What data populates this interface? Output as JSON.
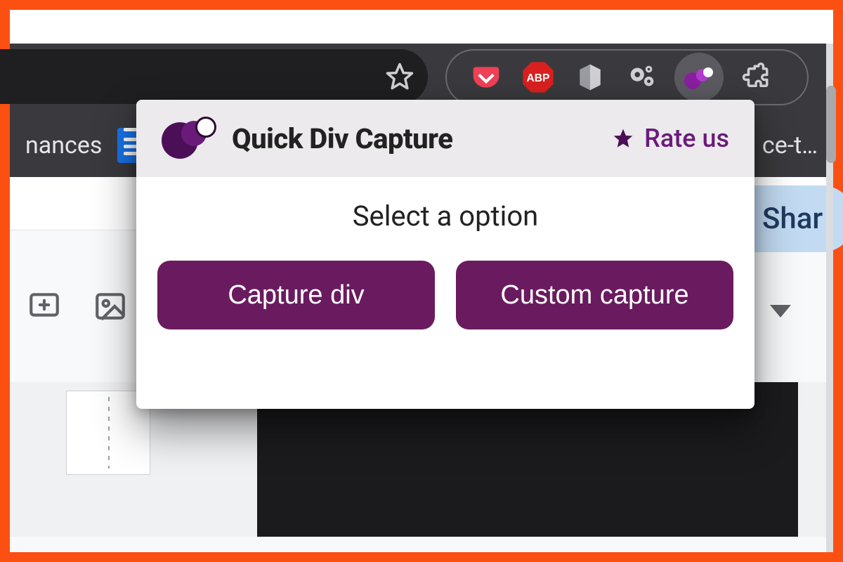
{
  "chrome": {
    "bookmarks_left_text": "nances",
    "bookmarks_right_text": "ce-t…"
  },
  "docs_page": {
    "share_label": "Shar"
  },
  "popup": {
    "title": "Quick Div Capture",
    "rate_label": "Rate us",
    "prompt": "Select a option",
    "buttons": {
      "capture_div": "Capture div",
      "custom_capture": "Custom capture"
    }
  },
  "icons": {
    "star": "star-outline",
    "pocket": "pocket",
    "abp": "ABP",
    "office": "office",
    "gears": "gears",
    "quickdiv": "quick-div-capture",
    "puzzle": "extensions"
  }
}
